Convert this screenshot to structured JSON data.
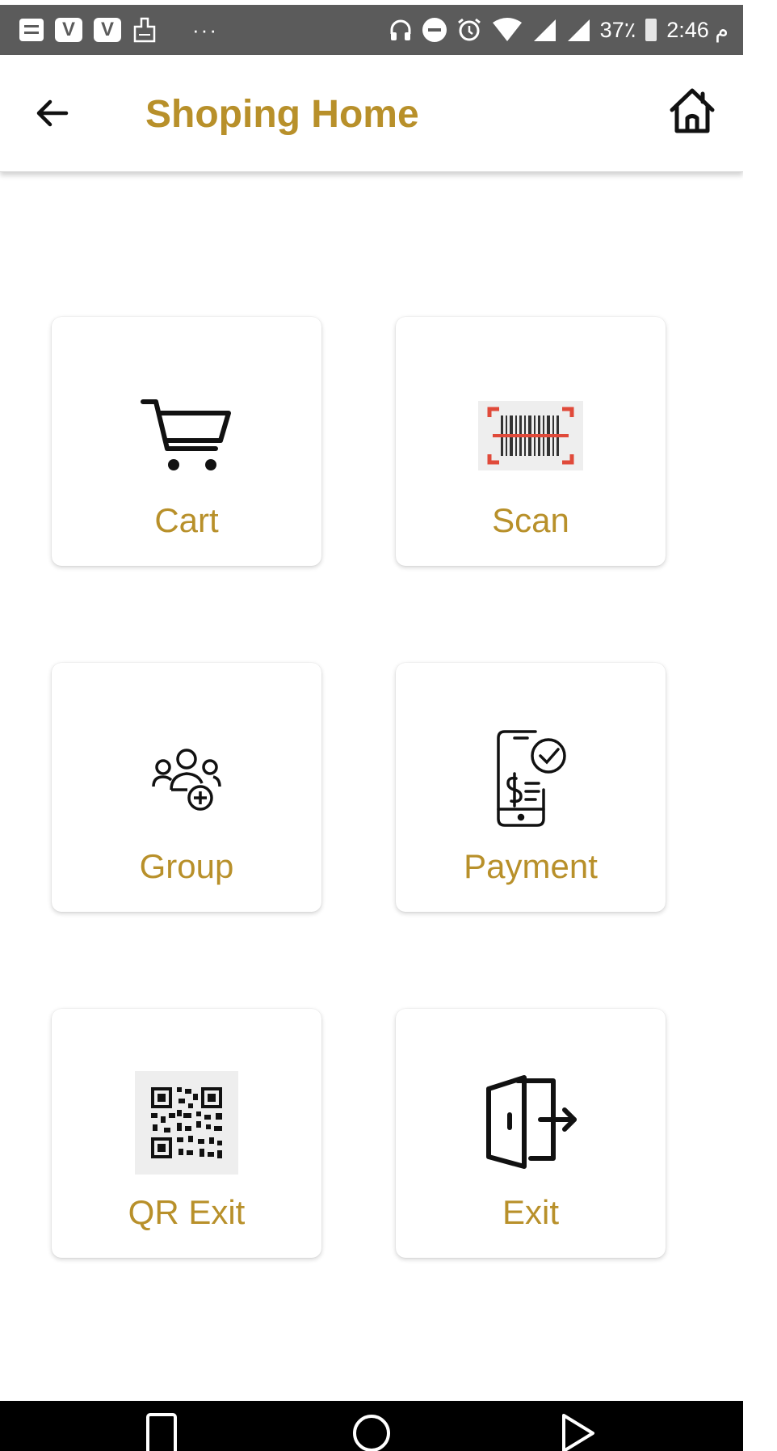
{
  "status_bar": {
    "battery_text": "37٪",
    "time_text": "م 2:46",
    "vpn_label": "V"
  },
  "app_bar": {
    "title": "Shoping Home"
  },
  "tiles": [
    {
      "label": "Cart",
      "icon": "shopping-cart-icon"
    },
    {
      "label": "Scan",
      "icon": "barcode-scan-icon"
    },
    {
      "label": "Group",
      "icon": "group-add-icon"
    },
    {
      "label": "Payment",
      "icon": "mobile-payment-icon"
    },
    {
      "label": "QR Exit",
      "icon": "qr-code-icon"
    },
    {
      "label": "Exit",
      "icon": "exit-door-icon"
    }
  ],
  "colors": {
    "accent": "#b8902a",
    "status_bar": "#5b5b5b",
    "nav_bar": "#000000"
  }
}
